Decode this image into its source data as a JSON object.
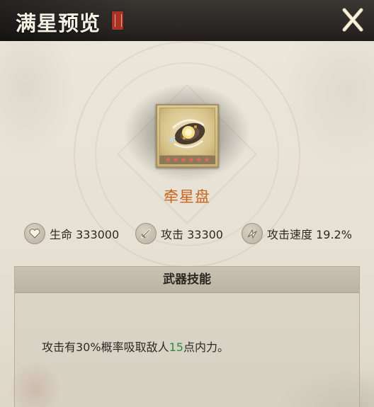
{
  "header": {
    "title": "满星预览",
    "close_label": "Close"
  },
  "item": {
    "name": "牵星盘",
    "stars": [
      "★",
      "★",
      "★",
      "★",
      "★",
      "★"
    ],
    "star_color": "#e4675a",
    "name_color": "#c8641e"
  },
  "stats": [
    {
      "icon": "heart-icon",
      "label": "生命 333000"
    },
    {
      "icon": "sword-icon",
      "label": "攻击 33300"
    },
    {
      "icon": "speed-icon",
      "label": "攻击速度 19.2%"
    }
  ],
  "skill": {
    "header": "武器技能",
    "desc_prefix": "攻击有30%概率吸取敌人",
    "desc_value": "15",
    "desc_suffix": "点内力。",
    "value_color": "#2f8a45"
  }
}
